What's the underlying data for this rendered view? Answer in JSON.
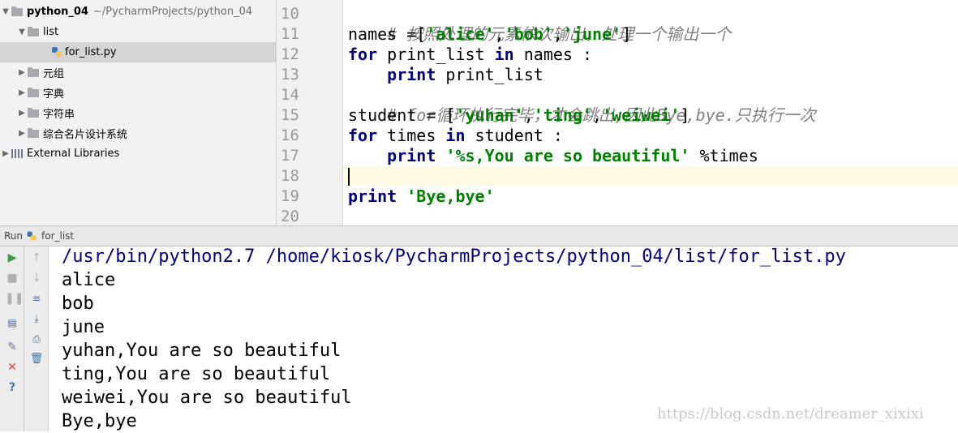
{
  "project_tree": {
    "root_name": "python_04",
    "root_path": "~/PycharmProjects/python_04",
    "items": [
      {
        "label": "list"
      },
      {
        "label": "for_list.py"
      },
      {
        "label": "元组"
      },
      {
        "label": "字典"
      },
      {
        "label": "字符串"
      },
      {
        "label": "综合名片设计系统"
      },
      {
        "label": "External Libraries"
      }
    ]
  },
  "editor": {
    "line_numbers": [
      "10",
      "11",
      "12",
      "13",
      "14",
      "15",
      "16",
      "17",
      "18",
      "19",
      "20"
    ],
    "lines": {
      "l10": {
        "comment": "# 按照处理的元素依次输出，处理一个输出一个"
      },
      "l11": {
        "a": "names =[",
        "s1": "'alice'",
        "c1": ",",
        "s2": "'bob'",
        "c2": ",",
        "s3": "'june'",
        "b": "]"
      },
      "l12": {
        "kw1": "for",
        "t1": " print_list ",
        "kw2": "in",
        "t2": " names :"
      },
      "l13": {
        "indent": "    ",
        "kw": "print",
        "t": " print_list"
      },
      "l14": {
        "comment": "# for循环执行完毕，才会跳出,因此Bye,bye.只执行一次"
      },
      "l15": {
        "a": "student = [",
        "s1": "'yuhan'",
        "c1": ",",
        "s2": "'ting'",
        "c2": ",",
        "s3": "'weiwei'",
        "b": "]"
      },
      "l16": {
        "kw1": "for",
        "t1": " times ",
        "kw2": "in",
        "t2": " student :"
      },
      "l17": {
        "indent": "    ",
        "kw": "print",
        "sp": " ",
        "s": "'%s,You are so beautiful'",
        "t": " %times"
      },
      "l19": {
        "kw": "print",
        "sp": " ",
        "s": "'Bye,bye'"
      }
    }
  },
  "run_panel": {
    "label": "Run",
    "config": "for_list",
    "output": [
      "/usr/bin/python2.7 /home/kiosk/PycharmProjects/python_04/list/for_list.py",
      "alice",
      "bob",
      "june",
      "yuhan,You are so beautiful",
      "ting,You are so beautiful",
      "weiwei,You are so beautiful",
      "Bye,bye"
    ]
  },
  "watermark": "https://blog.csdn.net/dreamer_xixixi",
  "colors": {
    "keyword": "#000080",
    "string": "#008000",
    "comment": "#808080",
    "selection": "#d5d5d5",
    "run_green": "#3c9b3c",
    "close_red": "#d94a3a"
  }
}
